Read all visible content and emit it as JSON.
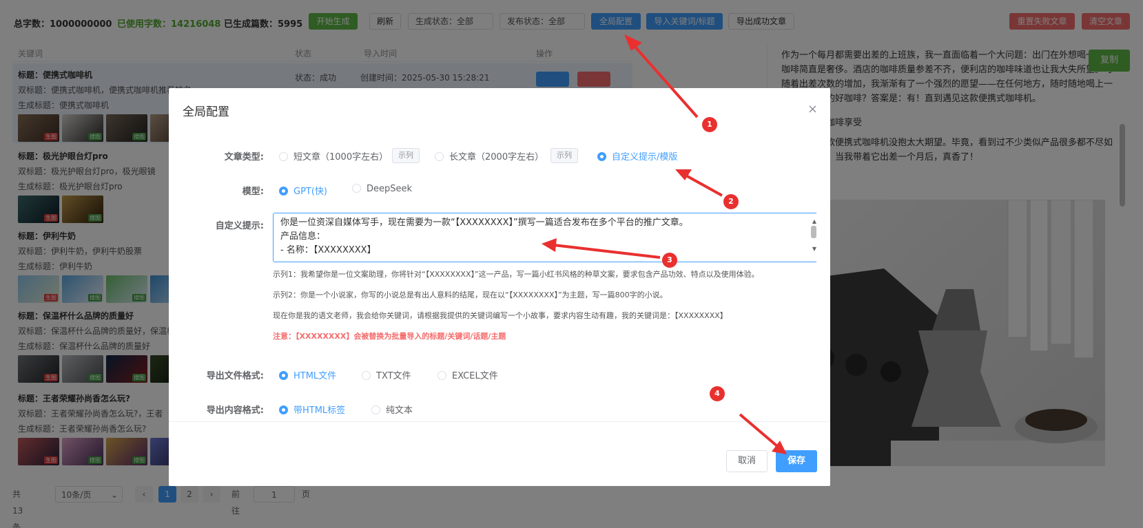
{
  "toolbar": {
    "total_label": "总字数：",
    "total_value": "1000000000",
    "used_label": "已使用字数：",
    "used_value": "14216048",
    "generated_label": "已生成篇数：",
    "generated_value": "5995",
    "start_btn": "开始生成",
    "refresh_btn": "刷新",
    "gen_status": "生成状态：全部",
    "pub_status": "发布状态：全部",
    "global_cfg_btn": "全局配置",
    "import_btn": "导入关键词/标题",
    "export_btn": "导出成功文章",
    "reset_btn": "重置失败文章",
    "clear_btn": "清空文章"
  },
  "table": {
    "headers": [
      "关键词",
      "状态",
      "导入时间",
      "操作"
    ],
    "first_status": "状态：成功",
    "first_time": "创建时间：2025-05-30 15:28:21",
    "rows": [
      {
        "title": "标题：便携式咖啡机",
        "sub": "双标题：便携式咖啡机，便携式咖啡机推荐排名",
        "gen": "生成标题：便携式咖啡机",
        "tags": [
          "生图",
          "搜图",
          "搜图",
          "搜图"
        ]
      },
      {
        "title": "标题：极光护眼台灯pro",
        "sub": "双标题：极光护眼台灯pro，极光眼镜",
        "gen": "生成标题：极光护眼台灯pro",
        "tags": [
          "生图",
          "搜图"
        ]
      },
      {
        "title": "标题：伊利牛奶",
        "sub": "双标题：伊利牛奶，伊利牛奶股票",
        "gen": "生成标题：伊利牛奶",
        "tags": [
          "生图",
          "搜图",
          "搜图",
          "搜图"
        ]
      },
      {
        "title": "标题：保温杯什么品牌的质量好",
        "sub": "双标题：保温杯什么品牌的质量好，保温杯",
        "gen": "生成标题：保温杯什么品牌的质量好",
        "tags": [
          "生图",
          "搜图",
          "搜图",
          "搜图"
        ]
      },
      {
        "title": "标题：王者荣耀孙尚香怎么玩?",
        "sub": "双标题：王者荣耀孙尚香怎么玩?，王者",
        "gen": "生成标题：王者荣耀孙尚香怎么玩?",
        "tags": [
          "生图",
          "搜图",
          "搜图",
          "搜图"
        ]
      }
    ]
  },
  "pager": {
    "total": "共 13 条",
    "size": "10条/页",
    "pages": [
      "1",
      "2"
    ],
    "goto": "前往",
    "goto_value": "1",
    "page_unit": "页"
  },
  "article": {
    "copy_btn": "复制",
    "p1": "作为一个每月都需要出差的上班族，我一直面临着一个大问题：出门在外想喝一杯好咖啡简直是奢侈。酒店的咖啡质量参差不齐，便利店的咖啡味道也让我大失所望。可随着出差次数的增加，我渐渐有了一个强烈的愿望——在任何地方，随时随地喝上一杯自己调配的好咖啡？答案是：有！直到遇见这款便携式咖啡机。",
    "sub": "随时随地的咖啡享受",
    "p2": "开始我对这款便携式咖啡机没抱太大期望。毕竟，看到过不少类似产品很多都不尽如人意。不过，当我带着它出差一个月后，真香了！"
  },
  "dialog": {
    "title": "全局配置",
    "close": "×",
    "article_type_label": "文章类型:",
    "type_short": "短文章（1000字左右）",
    "type_long": "长文章（2000字左右）",
    "type_custom": "自定义提示/模版",
    "example_btn": "示列",
    "model_label": "模型:",
    "model_gpt": "GPT(快)",
    "model_deepseek": "DeepSeek",
    "prompt_label": "自定义提示:",
    "prompt_line1": "你是一位资深自媒体写手，现在需要为一款“【XXXXXXXX】”撰写一篇适合发布在多个平台的推广文章。",
    "prompt_line2": "产品信息：",
    "prompt_line3": "- 名称：【XXXXXXXX】",
    "hint1": "示列1：我希望你是一位文案助理，你将针对“【XXXXXXXX】”这一产品，写一篇小红书风格的种草文案，要求包含产品功效、特点以及使用体验。",
    "hint2": "示列2：你是一个小说家，你写的小说总是有出人意料的结尾，现在以“【XXXXXXXX】”为主题，写一篇800字的小说。",
    "hint3": "现在你是我的语文老师，我会给你关键词，请根据我提供的关键词编写一个小故事，要求内容生动有趣，我的关键词是：【XXXXXXXX】",
    "hint_warn": "注意：【XXXXXXXX】会被替换为批量导入的标题/关键词/话题/主题",
    "export_file_label": "导出文件格式:",
    "file_html": "HTML文件",
    "file_txt": "TXT文件",
    "file_excel": "EXCEL文件",
    "export_content_label": "导出内容格式:",
    "content_html": "带HTML标签",
    "content_text": "纯文本",
    "cancel_btn": "取消",
    "save_btn": "保存"
  },
  "markers": [
    "1",
    "2",
    "3",
    "4"
  ],
  "colors": {
    "primary": "#409eff",
    "success": "#5fb846",
    "danger": "#f56c6c",
    "annotation": "#e9302f"
  }
}
